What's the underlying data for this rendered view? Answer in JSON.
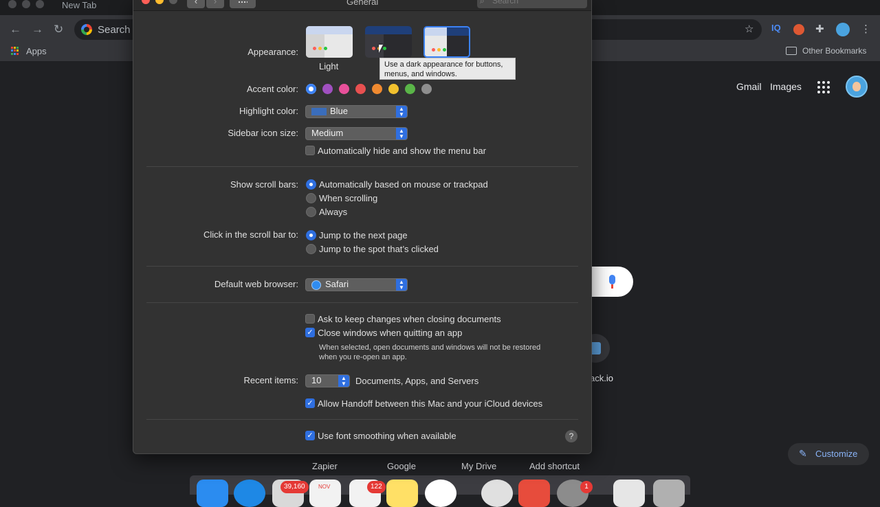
{
  "chrome": {
    "tab_title": "New Tab",
    "omnibox_text": "Search",
    "bookmarks_apps": "Apps",
    "other_bookmarks": "Other Bookmarks",
    "extension_iq": "IQ",
    "header_links": [
      "Gmail",
      "Images"
    ],
    "shortcut_partial_label": "ack.io",
    "shortcuts": [
      "Zapier",
      "Google",
      "My Drive",
      "Add shortcut"
    ],
    "customize": "Customize"
  },
  "prefs": {
    "window_title": "General",
    "search_placeholder": "Search",
    "appearance_label": "Appearance:",
    "appearance_options": [
      "Light",
      "Dark",
      "Auto"
    ],
    "appearance_selected": "Auto",
    "appearance_tooltip_line1": "Use a dark appearance for buttons,",
    "appearance_tooltip_line2": "menus, and windows.",
    "accent_label": "Accent color:",
    "accent_colors": [
      "#3b82f6",
      "#a050c0",
      "#e8509a",
      "#e85050",
      "#f08a30",
      "#f2c12e",
      "#5ab548",
      "#8e8e8e"
    ],
    "highlight_label": "Highlight color:",
    "highlight_value": "Blue",
    "highlight_swatch": "#3a6dbb",
    "sidebar_label": "Sidebar icon size:",
    "sidebar_value": "Medium",
    "auto_hide_menu_bar": "Automatically hide and show the menu bar",
    "scroll_bars_label": "Show scroll bars:",
    "scroll_bars_options": [
      "Automatically based on mouse or trackpad",
      "When scrolling",
      "Always"
    ],
    "scroll_bars_selected": 0,
    "click_scroll_label": "Click in the scroll bar to:",
    "click_scroll_options": [
      "Jump to the next page",
      "Jump to the spot that’s clicked"
    ],
    "click_scroll_selected": 0,
    "browser_label": "Default web browser:",
    "browser_value": "Safari",
    "ask_keep_changes": "Ask to keep changes when closing documents",
    "close_windows": "Close windows when quitting an app",
    "close_windows_note_1": "When selected, open documents and windows will not be restored",
    "close_windows_note_2": "when you re-open an app.",
    "recent_label": "Recent items:",
    "recent_value": "10",
    "recent_suffix": "Documents, Apps, and Servers",
    "handoff": "Allow Handoff between this Mac and your iCloud devices",
    "font_smoothing": "Use font smoothing when available",
    "help": "?"
  },
  "dock": {
    "badges": [
      "39,160",
      "122",
      "1"
    ],
    "calendar_month": "NOV"
  }
}
